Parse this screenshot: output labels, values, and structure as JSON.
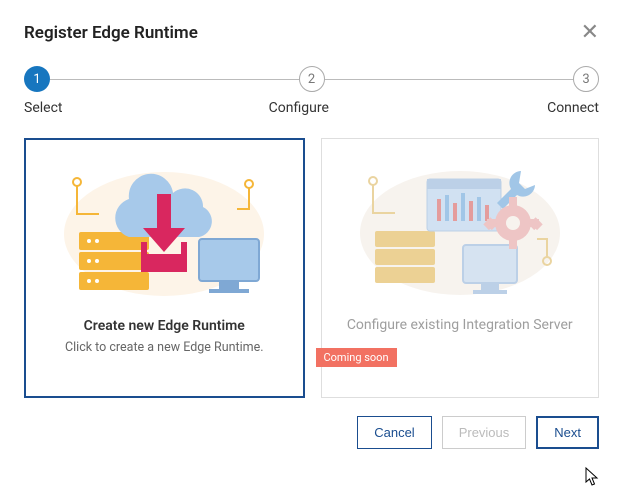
{
  "header": {
    "title": "Register Edge Runtime"
  },
  "stepper": {
    "steps": [
      {
        "num": "1",
        "label": "Select",
        "active": true
      },
      {
        "num": "2",
        "label": "Configure",
        "active": false
      },
      {
        "num": "3",
        "label": "Connect",
        "active": false
      }
    ]
  },
  "cards": {
    "create": {
      "title": "Create new Edge Runtime",
      "subtitle": "Click to create a new Edge Runtime."
    },
    "configure": {
      "title": "Configure existing Integration Server",
      "badge": "Coming soon"
    }
  },
  "footer": {
    "cancel": "Cancel",
    "previous": "Previous",
    "next": "Next"
  }
}
